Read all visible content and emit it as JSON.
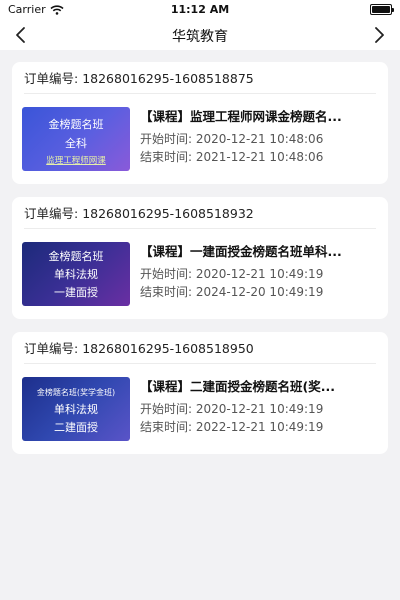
{
  "status_bar": {
    "carrier": "Carrier",
    "time": "11:12 AM"
  },
  "nav": {
    "title": "华筑教育"
  },
  "orders": [
    {
      "order_label": "订单编号:",
      "order_no": "18268016295-1608518875",
      "thumbnail_lines": [
        "金榜题名班",
        "全科",
        "监理工程师网课"
      ],
      "course_title": "【课程】监理工程师网课金榜题名...",
      "start_label": "开始时间:",
      "start_time": "2020-12-21 10:48:06",
      "end_label": "结束时间:",
      "end_time": "2021-12-21 10:48:06"
    },
    {
      "order_label": "订单编号:",
      "order_no": "18268016295-1608518932",
      "thumbnail_lines": [
        "金榜题名班",
        "单科法规",
        "一建面授"
      ],
      "course_title": "【课程】一建面授金榜题名班单科...",
      "start_label": "开始时间:",
      "start_time": "2020-12-21 10:49:19",
      "end_label": "结束时间:",
      "end_time": "2024-12-20 10:49:19"
    },
    {
      "order_label": "订单编号:",
      "order_no": "18268016295-1608518950",
      "thumbnail_lines": [
        "金榜题名班(奖学金班)",
        "单科法规",
        "二建面授"
      ],
      "course_title": "【课程】二建面授金榜题名班(奖...",
      "start_label": "开始时间:",
      "start_time": "2020-12-21 10:49:19",
      "end_label": "结束时间:",
      "end_time": "2022-12-21 10:49:19"
    }
  ],
  "icons": {
    "back": "chevron-left-icon",
    "forward": "chevron-right-icon",
    "wifi": "wifi-icon",
    "battery": "battery-icon"
  }
}
